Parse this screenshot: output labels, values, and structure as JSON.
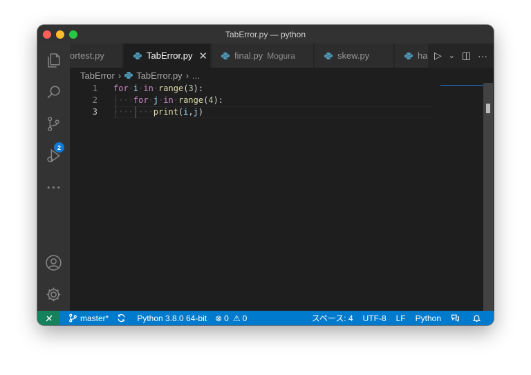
{
  "window": {
    "title": "TabError.py — python"
  },
  "tabs": [
    {
      "label": "ortest.py",
      "desc": "",
      "active": false
    },
    {
      "label": "TabError.py",
      "desc": "",
      "active": true
    },
    {
      "label": "final.py",
      "desc": "Mogura",
      "active": false
    },
    {
      "label": "skew.py",
      "desc": "",
      "active": false
    },
    {
      "label": "ha",
      "desc": "",
      "active": false
    }
  ],
  "tab_close_glyph": "✕",
  "tab_actions": {
    "run": "▷",
    "run_menu": "⌄",
    "split": "◫",
    "more": "···"
  },
  "breadcrumb": {
    "folder": "TabError",
    "file": "TabError.py",
    "trail": "..."
  },
  "editor": {
    "line_numbers": [
      "1",
      "2",
      "3"
    ],
    "current_line": 3,
    "lines": [
      "for i in range(3):",
      "    for j in range(4):",
      "        print(i,j)"
    ]
  },
  "activity_bar": {
    "items": [
      "explorer-icon",
      "search-icon",
      "source-control-icon",
      "run-debug-icon",
      "more-icon",
      "account-icon",
      "settings-gear-icon"
    ],
    "source_control_badge": "2"
  },
  "statusbar": {
    "branch": "master*",
    "interpreter": "Python 3.8.0 64-bit",
    "errors": "0",
    "warnings": "0",
    "indent": "スペース: 4",
    "encoding": "UTF-8",
    "eol": "LF",
    "language": "Python"
  },
  "colors": {
    "accent": "#007acc",
    "remote": "#16825d",
    "keyword": "#c586c0",
    "function": "#dcdcaa",
    "variable": "#9cdcfe",
    "number": "#b5cea8"
  }
}
